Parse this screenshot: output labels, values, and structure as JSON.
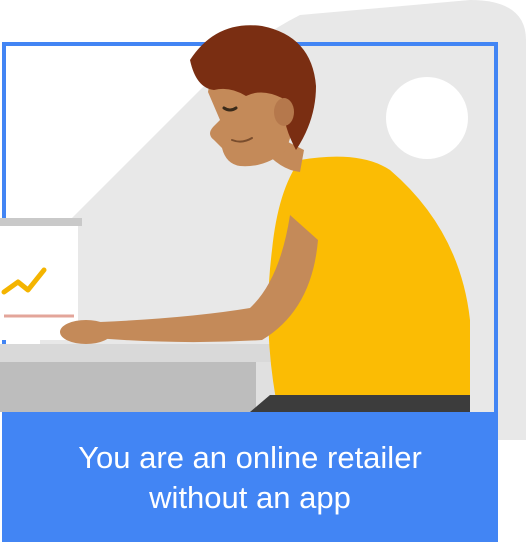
{
  "card": {
    "caption": "You are an online retailer without an app"
  },
  "colors": {
    "frame_blue": "#4285f4",
    "tag_gray": "#e8e8e8",
    "shirt_yellow": "#fbbc04",
    "skin": "#c48a59",
    "hair": "#7a2e12"
  },
  "icons": {
    "tag_hole": "circle",
    "chart_line": "trend-up-checkmark"
  }
}
